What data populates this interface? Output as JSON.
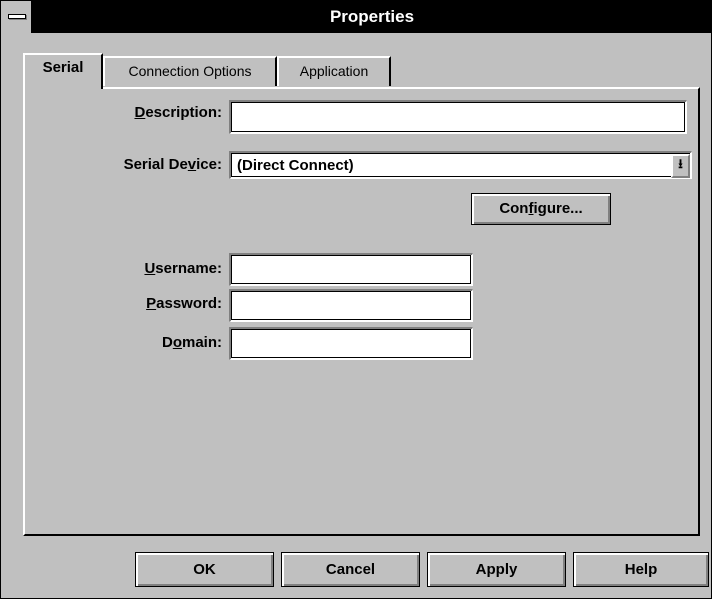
{
  "window": {
    "title": "Properties"
  },
  "tabs": [
    {
      "label": "Serial",
      "active": true
    },
    {
      "label": "Connection Options",
      "active": false
    },
    {
      "label": "Application",
      "active": false
    }
  ],
  "form": {
    "description": {
      "label_pre": "",
      "label_key": "D",
      "label_post": "escription:",
      "value": ""
    },
    "serial_device": {
      "label_pre": "Serial De",
      "label_key": "v",
      "label_post": "ice:",
      "value": "(Direct Connect)",
      "dropdown_icon": "arrow-down-icon"
    },
    "configure": {
      "pre": "Con",
      "key": "f",
      "post": "igure..."
    },
    "username": {
      "label_pre": "",
      "label_key": "U",
      "label_post": "sername:",
      "value": ""
    },
    "password": {
      "label_pre": "",
      "label_key": "P",
      "label_post": "assword:",
      "value": ""
    },
    "domain": {
      "label_pre": "D",
      "label_key": "o",
      "label_post": "main:",
      "value": ""
    }
  },
  "buttons": {
    "ok": "OK",
    "cancel": "Cancel",
    "apply": "Apply",
    "help": "Help"
  }
}
